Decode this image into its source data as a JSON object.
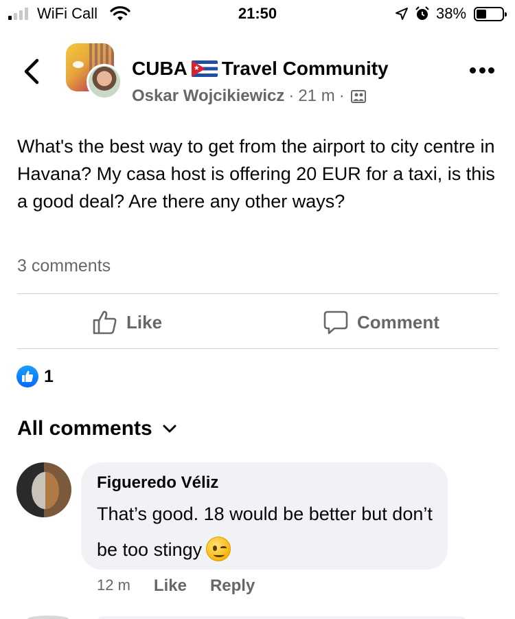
{
  "status_bar": {
    "carrier": "WiFi Call",
    "time": "21:50",
    "battery_percent": "38%",
    "battery_level": 0.38,
    "signal_bars_active": 1,
    "icons": [
      "signal-bars-icon",
      "wifi-icon",
      "location-arrow-icon",
      "alarm-clock-icon",
      "battery-icon"
    ]
  },
  "header": {
    "group_name_part1": "CUBA",
    "group_name_part2": "Travel Community",
    "author": "Oskar Wojcikiewicz",
    "time_ago": "21 m",
    "separator": "·",
    "icons": [
      "back-chevron-icon",
      "cuba-flag-icon",
      "group-icon",
      "more-dots-icon"
    ]
  },
  "post": {
    "text": "What's the best way to get from the airport to city centre in Havana? My casa host is offering 20 EUR for a taxi, is this a good deal? Are there any other ways?",
    "comments_count": "3 comments"
  },
  "actions": {
    "like_label": "Like",
    "comment_label": "Comment"
  },
  "reactions": {
    "count": "1",
    "icon": "thumbs-up-reaction-icon"
  },
  "comments_section": {
    "filter_label": "All comments"
  },
  "comments": [
    {
      "author": "Figueredo Véliz",
      "text": "That’s good. 18 would be better but don’t be too stingy",
      "emoji": "winking-face-emoji",
      "time": "12 m",
      "like_label": "Like",
      "reply_label": "Reply"
    }
  ],
  "colors": {
    "text_primary": "#050505",
    "text_secondary": "#65676b",
    "divider": "#ced0d4",
    "comment_bubble": "#f0f2f5",
    "reaction_blue": "#0866ff"
  }
}
